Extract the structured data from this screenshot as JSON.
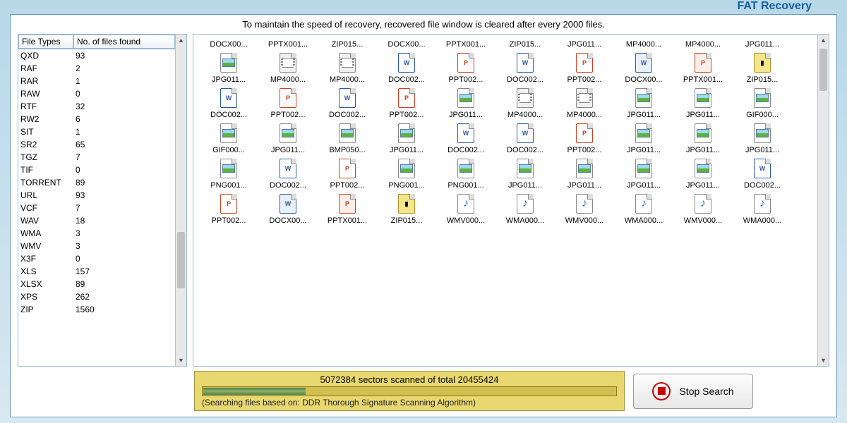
{
  "header": {
    "app_title_partial": "FAT Recovery"
  },
  "info_text": "To maintain the speed of recovery, recovered file window is cleared after every 2000 files.",
  "left_table": {
    "col1": "File Types",
    "col2": "No. of files found",
    "rows": [
      {
        "t": "QXD",
        "n": "93"
      },
      {
        "t": "RAF",
        "n": "2"
      },
      {
        "t": "RAR",
        "n": "1"
      },
      {
        "t": "RAW",
        "n": "0"
      },
      {
        "t": "RTF",
        "n": "32"
      },
      {
        "t": "RW2",
        "n": "6"
      },
      {
        "t": "SIT",
        "n": "1"
      },
      {
        "t": "SR2",
        "n": "65"
      },
      {
        "t": "TGZ",
        "n": "7"
      },
      {
        "t": "TIF",
        "n": "0"
      },
      {
        "t": "TORRENT",
        "n": "89"
      },
      {
        "t": "URL",
        "n": "93"
      },
      {
        "t": "VCF",
        "n": "7"
      },
      {
        "t": "WAV",
        "n": "18"
      },
      {
        "t": "WMA",
        "n": "3"
      },
      {
        "t": "WMV",
        "n": "3"
      },
      {
        "t": "X3F",
        "n": "0"
      },
      {
        "t": "XLS",
        "n": "157"
      },
      {
        "t": "XLSX",
        "n": "89"
      },
      {
        "t": "XPS",
        "n": "262"
      },
      {
        "t": "ZIP",
        "n": "1560"
      }
    ]
  },
  "files": {
    "row0": [
      {
        "name": "DOCX00...",
        "type": "docx"
      },
      {
        "name": "PPTX001...",
        "type": "pptx"
      },
      {
        "name": "ZIP015...",
        "type": "zip"
      },
      {
        "name": "DOCX00...",
        "type": "docx"
      },
      {
        "name": "PPTX001...",
        "type": "pptx"
      },
      {
        "name": "ZIP015...",
        "type": "zip"
      },
      {
        "name": "JPG011...",
        "type": "jpg"
      },
      {
        "name": "MP4000...",
        "type": "mp4"
      },
      {
        "name": "MP4000...",
        "type": "mp4"
      },
      {
        "name": "JPG011...",
        "type": "jpg"
      }
    ],
    "row1": [
      {
        "name": "JPG011...",
        "type": "jpg"
      },
      {
        "name": "MP4000...",
        "type": "mp4"
      },
      {
        "name": "MP4000...",
        "type": "mp4"
      },
      {
        "name": "DOC002...",
        "type": "doc"
      },
      {
        "name": "PPT002...",
        "type": "ppt"
      },
      {
        "name": "DOC002...",
        "type": "doc"
      },
      {
        "name": "PPT002...",
        "type": "ppt"
      },
      {
        "name": "DOCX00...",
        "type": "docx"
      },
      {
        "name": "PPTX001...",
        "type": "pptx"
      },
      {
        "name": "ZIP015...",
        "type": "zip"
      }
    ],
    "row2": [
      {
        "name": "DOC002...",
        "type": "doc"
      },
      {
        "name": "PPT002...",
        "type": "ppt"
      },
      {
        "name": "DOC002...",
        "type": "doc"
      },
      {
        "name": "PPT002...",
        "type": "ppt"
      },
      {
        "name": "JPG011...",
        "type": "jpg"
      },
      {
        "name": "MP4000...",
        "type": "mp4"
      },
      {
        "name": "MP4000...",
        "type": "mp4"
      },
      {
        "name": "JPG011...",
        "type": "jpg"
      },
      {
        "name": "JPG011...",
        "type": "jpg"
      },
      {
        "name": "GIF000...",
        "type": "gif"
      }
    ],
    "row3": [
      {
        "name": "GIF000...",
        "type": "gif"
      },
      {
        "name": "JPG011...",
        "type": "jpg"
      },
      {
        "name": "BMP050...",
        "type": "bmp"
      },
      {
        "name": "JPG011...",
        "type": "jpg"
      },
      {
        "name": "DOC002...",
        "type": "doc"
      },
      {
        "name": "DOC002...",
        "type": "doc"
      },
      {
        "name": "PPT002...",
        "type": "ppt"
      },
      {
        "name": "JPG011...",
        "type": "jpg"
      },
      {
        "name": "JPG011...",
        "type": "jpg"
      },
      {
        "name": "JPG011...",
        "type": "jpg"
      }
    ],
    "row4": [
      {
        "name": "PNG001...",
        "type": "png"
      },
      {
        "name": "DOC002...",
        "type": "doc"
      },
      {
        "name": "PPT002...",
        "type": "ppt"
      },
      {
        "name": "PNG001...",
        "type": "png"
      },
      {
        "name": "PNG001...",
        "type": "png"
      },
      {
        "name": "JPG011...",
        "type": "jpg"
      },
      {
        "name": "JPG011...",
        "type": "jpg"
      },
      {
        "name": "JPG011...",
        "type": "jpg"
      },
      {
        "name": "JPG011...",
        "type": "jpg"
      },
      {
        "name": "DOC002...",
        "type": "doc"
      }
    ],
    "row5": [
      {
        "name": "PPT002...",
        "type": "ppt"
      },
      {
        "name": "DOCX00...",
        "type": "docx"
      },
      {
        "name": "PPTX001...",
        "type": "pptx"
      },
      {
        "name": "ZIP015...",
        "type": "zip"
      },
      {
        "name": "WMV000...",
        "type": "wmv"
      },
      {
        "name": "WMA000...",
        "type": "wma"
      },
      {
        "name": "WMV000...",
        "type": "wmv"
      },
      {
        "name": "WMA000...",
        "type": "wma"
      },
      {
        "name": "WMV000...",
        "type": "wmv"
      },
      {
        "name": "WMA000...",
        "type": "wma"
      }
    ]
  },
  "progress": {
    "sectors_text": "5072384 sectors scanned of total 20455424",
    "percent": 24.8,
    "algo_text": "(Searching files based on:  DDR Thorough Signature Scanning Algorithm)"
  },
  "buttons": {
    "stop": "Stop Search"
  }
}
